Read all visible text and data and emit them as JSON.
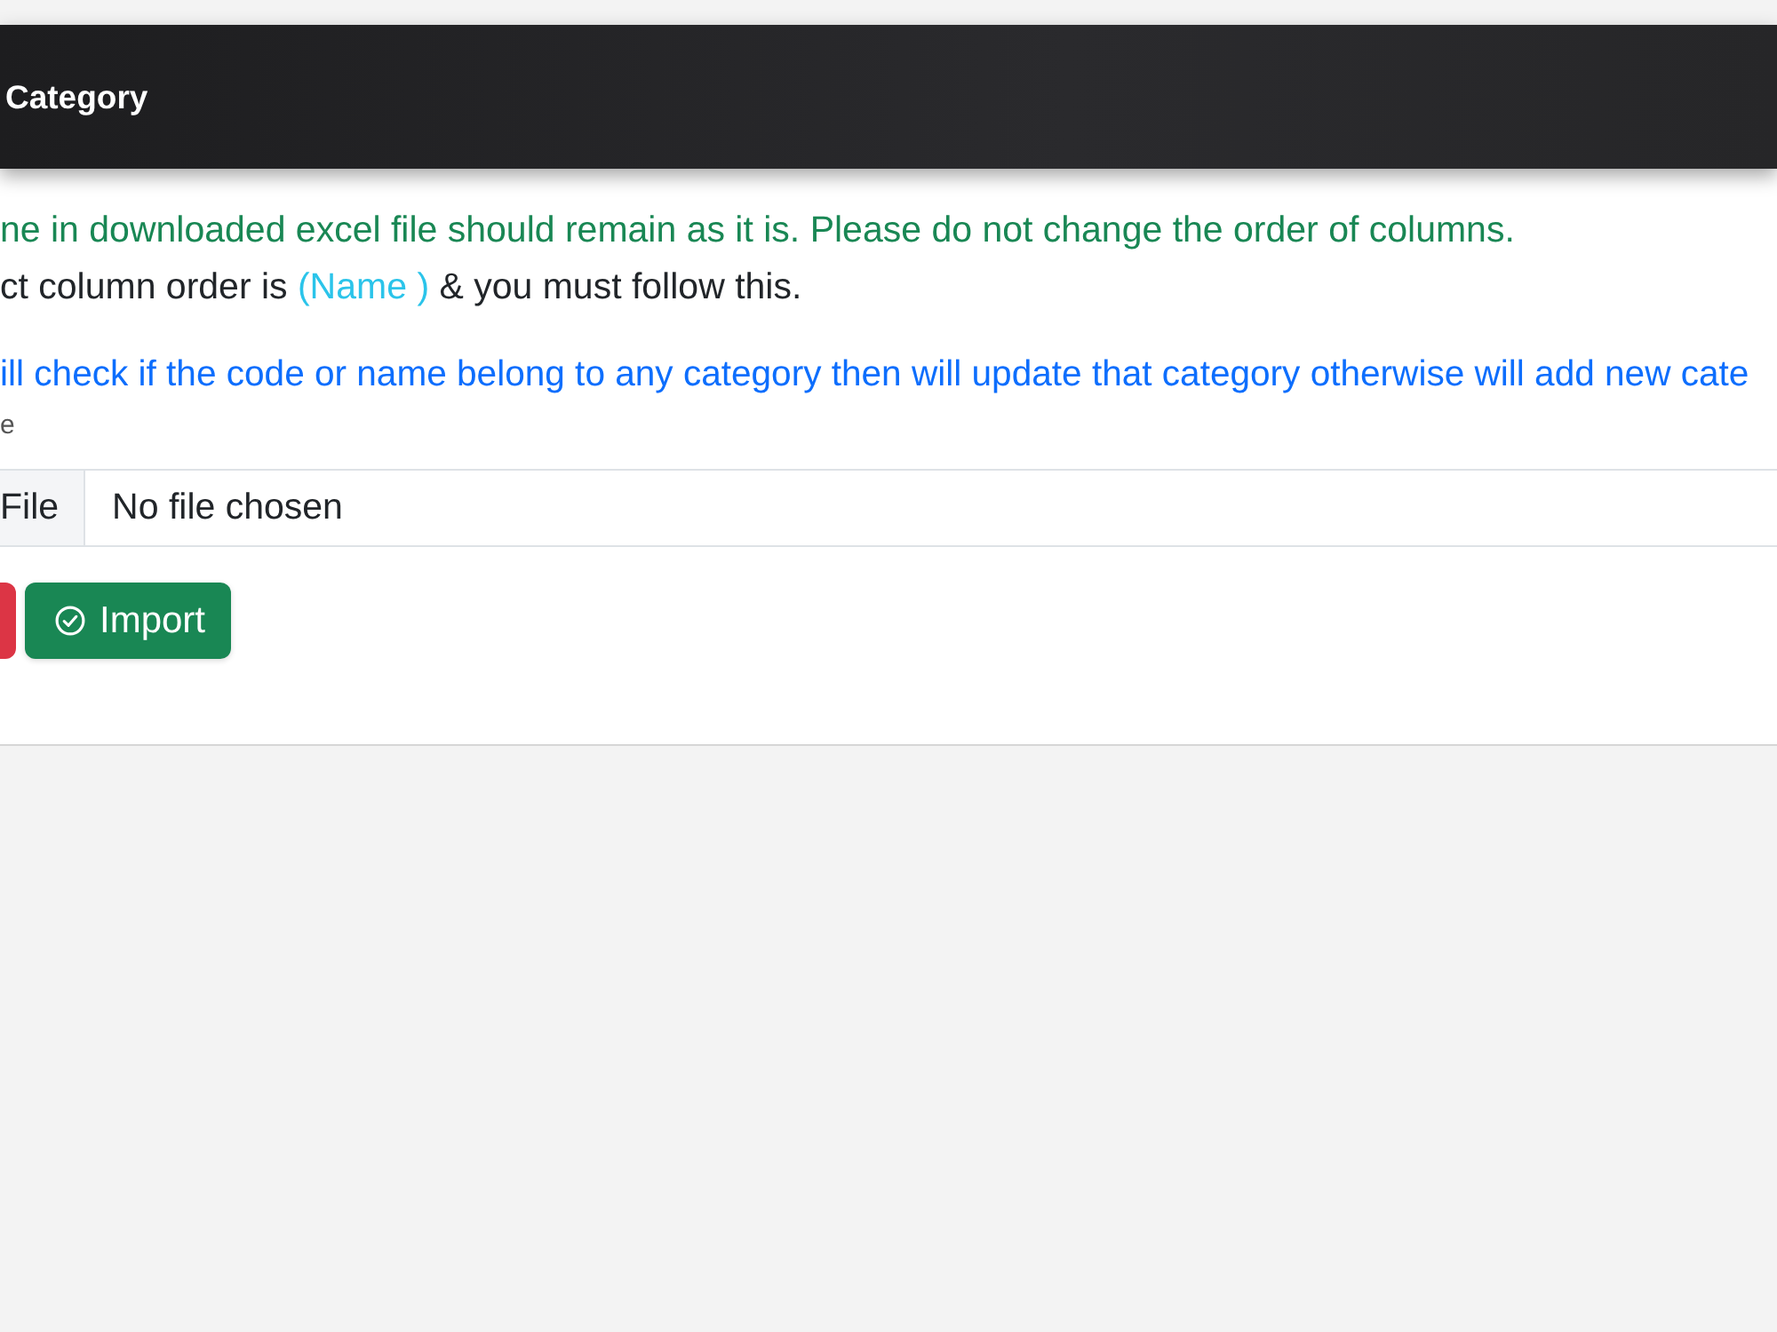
{
  "header": {
    "title": "Category"
  },
  "notes": [
    {
      "kind": "success",
      "parts": [
        {
          "kind": "text",
          "text": "ne in downloaded excel file should remain as it is. Please do not change the order of columns."
        }
      ]
    },
    {
      "kind": "plain",
      "parts": [
        {
          "kind": "text",
          "text": "ct column order is "
        },
        {
          "kind": "highlight",
          "text": "(Name )"
        },
        {
          "kind": "text",
          "text": " & you must follow this."
        }
      ]
    },
    {
      "kind": "primary",
      "parts": [
        {
          "kind": "text",
          "text": "ill check if the code or name belong to any category then will update that category otherwise will add new cate"
        }
      ]
    },
    {
      "kind": "hint",
      "parts": [
        {
          "kind": "text",
          "text": "e"
        }
      ]
    }
  ],
  "file_input": {
    "button": "File",
    "value": "No file chosen"
  },
  "buttons": [
    {
      "kind": "danger"
    },
    {
      "kind": "success",
      "label": "Import"
    }
  ]
}
